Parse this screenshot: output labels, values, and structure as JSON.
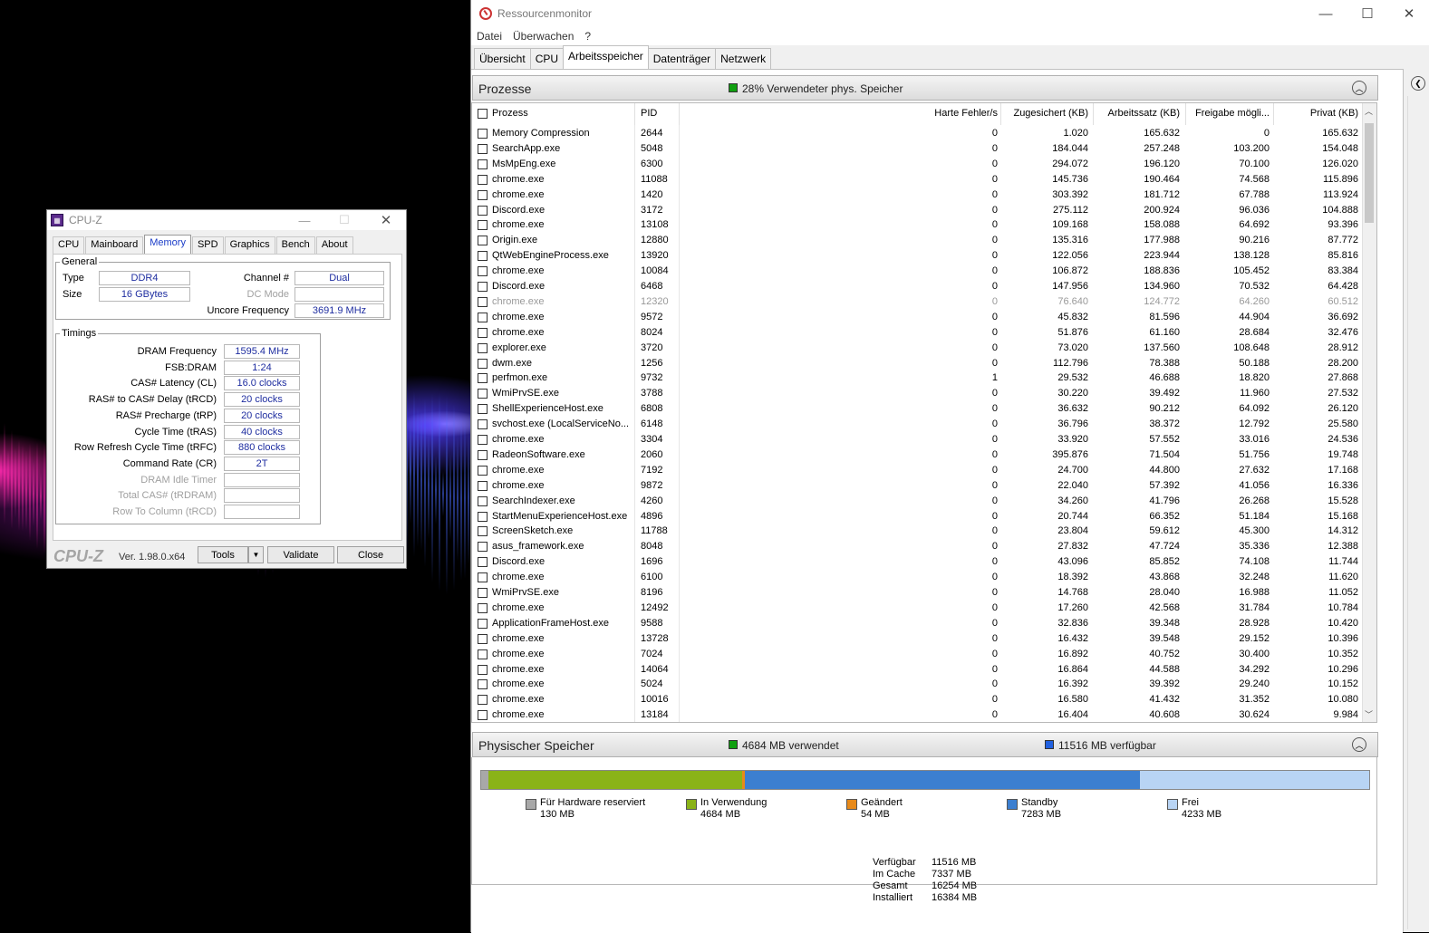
{
  "cpuz": {
    "title": "CPU-Z",
    "tabs": [
      "CPU",
      "Mainboard",
      "Memory",
      "SPD",
      "Graphics",
      "Bench",
      "About"
    ],
    "active_tab": "Memory",
    "general": {
      "legend": "General",
      "type_label": "Type",
      "type_value": "DDR4",
      "size_label": "Size",
      "size_value": "16 GBytes",
      "channel_label": "Channel #",
      "channel_value": "Dual",
      "dcmode_label": "DC Mode",
      "dcmode_value": "",
      "uncore_label": "Uncore Frequency",
      "uncore_value": "3691.9 MHz"
    },
    "timings": {
      "legend": "Timings",
      "rows": [
        {
          "label": "DRAM Frequency",
          "value": "1595.4 MHz",
          "enabled": true
        },
        {
          "label": "FSB:DRAM",
          "value": "1:24",
          "enabled": true
        },
        {
          "label": "CAS# Latency (CL)",
          "value": "16.0 clocks",
          "enabled": true
        },
        {
          "label": "RAS# to CAS# Delay (tRCD)",
          "value": "20 clocks",
          "enabled": true
        },
        {
          "label": "RAS# Precharge (tRP)",
          "value": "20 clocks",
          "enabled": true
        },
        {
          "label": "Cycle Time (tRAS)",
          "value": "40 clocks",
          "enabled": true
        },
        {
          "label": "Row Refresh Cycle Time (tRFC)",
          "value": "880 clocks",
          "enabled": true
        },
        {
          "label": "Command Rate (CR)",
          "value": "2T",
          "enabled": true
        },
        {
          "label": "DRAM Idle Timer",
          "value": "",
          "enabled": false
        },
        {
          "label": "Total CAS# (tRDRAM)",
          "value": "",
          "enabled": false
        },
        {
          "label": "Row To Column (tRCD)",
          "value": "",
          "enabled": false
        }
      ]
    },
    "footer": {
      "brand": "CPU-Z",
      "version": "Ver. 1.98.0.x64",
      "tools_label": "Tools",
      "validate_label": "Validate",
      "close_label": "Close"
    }
  },
  "resmon": {
    "title": "Ressourcenmonitor",
    "menu": [
      "Datei",
      "Überwachen",
      "?"
    ],
    "tabs": [
      "Übersicht",
      "CPU",
      "Arbeitsspeicher",
      "Datenträger",
      "Netzwerk"
    ],
    "active_tab": "Arbeitsspeicher",
    "processes": {
      "title": "Prozesse",
      "indicator_text": "28% Verwendeter phys. Speicher",
      "indicator_color": "#10a010",
      "columns": [
        "Prozess",
        "PID",
        "Harte Fehler/s",
        "Zugesichert (KB)",
        "Arbeitssatz (KB)",
        "Freigabe mögli...",
        "Privat (KB)"
      ],
      "rows": [
        [
          "Memory Compression",
          "2644",
          "0",
          "1.020",
          "165.632",
          "0",
          "165.632"
        ],
        [
          "SearchApp.exe",
          "5048",
          "0",
          "184.044",
          "257.248",
          "103.200",
          "154.048"
        ],
        [
          "MsMpEng.exe",
          "6300",
          "0",
          "294.072",
          "196.120",
          "70.100",
          "126.020"
        ],
        [
          "chrome.exe",
          "11088",
          "0",
          "145.736",
          "190.464",
          "74.568",
          "115.896"
        ],
        [
          "chrome.exe",
          "1420",
          "0",
          "303.392",
          "181.712",
          "67.788",
          "113.924"
        ],
        [
          "Discord.exe",
          "3172",
          "0",
          "275.112",
          "200.924",
          "96.036",
          "104.888"
        ],
        [
          "chrome.exe",
          "13108",
          "0",
          "109.168",
          "158.088",
          "64.692",
          "93.396"
        ],
        [
          "Origin.exe",
          "12880",
          "0",
          "135.316",
          "177.988",
          "90.216",
          "87.772"
        ],
        [
          "QtWebEngineProcess.exe",
          "13920",
          "0",
          "122.056",
          "223.944",
          "138.128",
          "85.816"
        ],
        [
          "chrome.exe",
          "10084",
          "0",
          "106.872",
          "188.836",
          "105.452",
          "83.384"
        ],
        [
          "Discord.exe",
          "6468",
          "0",
          "147.956",
          "134.960",
          "70.532",
          "64.428"
        ],
        [
          "chrome.exe",
          "12320",
          "0",
          "76.640",
          "124.772",
          "64.260",
          "60.512"
        ],
        [
          "chrome.exe",
          "9572",
          "0",
          "45.832",
          "81.596",
          "44.904",
          "36.692"
        ],
        [
          "chrome.exe",
          "8024",
          "0",
          "51.876",
          "61.160",
          "28.684",
          "32.476"
        ],
        [
          "explorer.exe",
          "3720",
          "0",
          "73.020",
          "137.560",
          "108.648",
          "28.912"
        ],
        [
          "dwm.exe",
          "1256",
          "0",
          "112.796",
          "78.388",
          "50.188",
          "28.200"
        ],
        [
          "perfmon.exe",
          "9732",
          "1",
          "29.532",
          "46.688",
          "18.820",
          "27.868"
        ],
        [
          "WmiPrvSE.exe",
          "3788",
          "0",
          "30.220",
          "39.492",
          "11.960",
          "27.532"
        ],
        [
          "ShellExperienceHost.exe",
          "6808",
          "0",
          "36.632",
          "90.212",
          "64.092",
          "26.120"
        ],
        [
          "svchost.exe (LocalServiceNo...",
          "6148",
          "0",
          "36.796",
          "38.372",
          "12.792",
          "25.580"
        ],
        [
          "chrome.exe",
          "3304",
          "0",
          "33.920",
          "57.552",
          "33.016",
          "24.536"
        ],
        [
          "RadeonSoftware.exe",
          "2060",
          "0",
          "395.876",
          "71.504",
          "51.756",
          "19.748"
        ],
        [
          "chrome.exe",
          "7192",
          "0",
          "24.700",
          "44.800",
          "27.632",
          "17.168"
        ],
        [
          "chrome.exe",
          "9872",
          "0",
          "22.040",
          "57.392",
          "41.056",
          "16.336"
        ],
        [
          "SearchIndexer.exe",
          "4260",
          "0",
          "34.260",
          "41.796",
          "26.268",
          "15.528"
        ],
        [
          "StartMenuExperienceHost.exe",
          "4896",
          "0",
          "20.744",
          "66.352",
          "51.184",
          "15.168"
        ],
        [
          "ScreenSketch.exe",
          "11788",
          "0",
          "23.804",
          "59.612",
          "45.300",
          "14.312"
        ],
        [
          "asus_framework.exe",
          "8048",
          "0",
          "27.832",
          "47.724",
          "35.336",
          "12.388"
        ],
        [
          "Discord.exe",
          "1696",
          "0",
          "43.096",
          "85.852",
          "74.108",
          "11.744"
        ],
        [
          "chrome.exe",
          "6100",
          "0",
          "18.392",
          "43.868",
          "32.248",
          "11.620"
        ],
        [
          "WmiPrvSE.exe",
          "8196",
          "0",
          "14.768",
          "28.040",
          "16.988",
          "11.052"
        ],
        [
          "chrome.exe",
          "12492",
          "0",
          "17.260",
          "42.568",
          "31.784",
          "10.784"
        ],
        [
          "ApplicationFrameHost.exe",
          "9588",
          "0",
          "32.836",
          "39.348",
          "28.928",
          "10.420"
        ],
        [
          "chrome.exe",
          "13728",
          "0",
          "16.432",
          "39.548",
          "29.152",
          "10.396"
        ],
        [
          "chrome.exe",
          "7024",
          "0",
          "16.892",
          "40.752",
          "30.400",
          "10.352"
        ],
        [
          "chrome.exe",
          "14064",
          "0",
          "16.864",
          "44.588",
          "34.292",
          "10.296"
        ],
        [
          "chrome.exe",
          "5024",
          "0",
          "16.392",
          "39.392",
          "29.240",
          "10.152"
        ],
        [
          "chrome.exe",
          "10016",
          "0",
          "16.580",
          "41.432",
          "31.352",
          "10.080"
        ],
        [
          "chrome.exe",
          "13184",
          "0",
          "16.404",
          "40.608",
          "30.624",
          "9.984"
        ]
      ],
      "greyed_row_index": 11
    },
    "physical": {
      "title": "Physischer Speicher",
      "used_text": "4684 MB verwendet",
      "used_color": "#10a010",
      "avail_text": "11516 MB verfügbar",
      "avail_color": "#2060e0",
      "bar": [
        {
          "name": "Für Hardware reserviert",
          "mb": 130,
          "color": "#a8a8a8"
        },
        {
          "name": "In Verwendung",
          "mb": 4684,
          "color": "#8ab318"
        },
        {
          "name": "Geändert",
          "mb": 54,
          "color": "#e88a1a"
        },
        {
          "name": "Standby",
          "mb": 7283,
          "color": "#3c7fd0"
        },
        {
          "name": "Frei",
          "mb": 4233,
          "color": "#b8d4f4"
        }
      ],
      "legend": [
        {
          "label": "Für Hardware reserviert",
          "value": "130 MB"
        },
        {
          "label": "In Verwendung",
          "value": "4684 MB"
        },
        {
          "label": "Geändert",
          "value": "54 MB"
        },
        {
          "label": "Standby",
          "value": "7283 MB"
        },
        {
          "label": "Frei",
          "value": "4233 MB"
        }
      ],
      "summary": [
        {
          "label": "Verfügbar",
          "value": "11516 MB"
        },
        {
          "label": "Im Cache",
          "value": "7337 MB"
        },
        {
          "label": "Gesamt",
          "value": "16254 MB"
        },
        {
          "label": "Installiert",
          "value": "16384 MB"
        }
      ]
    }
  }
}
